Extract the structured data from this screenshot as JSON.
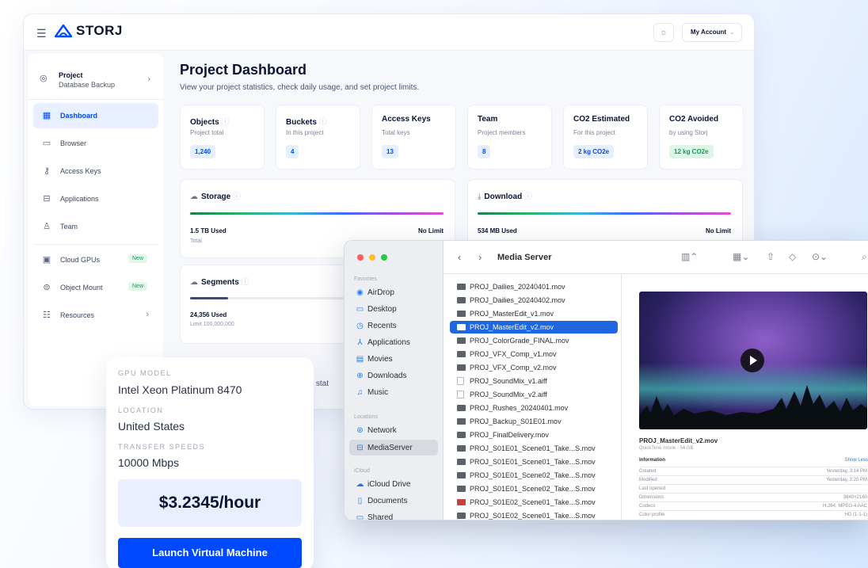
{
  "dashboard": {
    "brand": "STORJ",
    "account_label": "My Account",
    "project": {
      "label": "Project",
      "name": "Database Backup"
    },
    "nav": [
      {
        "label": "Dashboard",
        "icon": "grid-icon",
        "active": true
      },
      {
        "label": "Browser",
        "icon": "folder-icon"
      },
      {
        "label": "Access Keys",
        "icon": "key-icon"
      },
      {
        "label": "Applications",
        "icon": "apps-icon"
      },
      {
        "label": "Team",
        "icon": "user-icon"
      },
      {
        "label": "Cloud GPUs",
        "icon": "chip-icon",
        "badge": "New"
      },
      {
        "label": "Object Mount",
        "icon": "drive-icon",
        "badge": "New"
      },
      {
        "label": "Resources",
        "icon": "book-icon"
      }
    ],
    "title": "Project Dashboard",
    "subtitle": "View your project statistics, check daily usage, and set project limits.",
    "stats": [
      {
        "title": "Objects",
        "sub": "Project total",
        "value": "1,240"
      },
      {
        "title": "Buckets",
        "sub": "In this project",
        "value": "4"
      },
      {
        "title": "Access Keys",
        "sub": "Total keys",
        "value": "13"
      },
      {
        "title": "Team",
        "sub": "Project members",
        "value": "8"
      },
      {
        "title": "CO2 Estimated",
        "sub": "For this project",
        "value": "2 kg CO2e"
      },
      {
        "title": "CO2 Avoided",
        "sub": "by using Storj",
        "value": "12 kg CO2e"
      }
    ],
    "storage": {
      "title": "Storage",
      "used": "1.5 TB Used",
      "used_sub": "Total",
      "limit": "No Limit"
    },
    "download": {
      "title": "Download",
      "used": "534 MB Used",
      "limit": "No Limit"
    },
    "segments": {
      "title": "Segments",
      "used": "24,356 Used",
      "used_sub": "Limit 100,000,000",
      "fill_fraction": 0.15
    },
    "peek_text": "ge stat"
  },
  "gpu": {
    "model_label": "GPU MODEL",
    "model": "Intel Xeon Platinum 8470",
    "location_label": "LOCATION",
    "location": "United States",
    "speed_label": "TRANSFER SPEEDS",
    "speed": "10000 Mbps",
    "price": "$3.2345/hour",
    "launch_label": "Launch Virtual Machine"
  },
  "finder": {
    "title": "Media Server",
    "favorites_label": "Favorites",
    "favorites": [
      {
        "label": "AirDrop",
        "icon": "airdrop-icon"
      },
      {
        "label": "Desktop",
        "icon": "desktop-icon"
      },
      {
        "label": "Recents",
        "icon": "clock-icon"
      },
      {
        "label": "Applications",
        "icon": "applications-icon"
      },
      {
        "label": "Movies",
        "icon": "film-icon"
      },
      {
        "label": "Downloads",
        "icon": "download-icon"
      },
      {
        "label": "Music",
        "icon": "music-icon"
      }
    ],
    "locations_label": "Locations",
    "locations": [
      {
        "label": "Network",
        "icon": "globe-icon"
      },
      {
        "label": "MediaServer",
        "icon": "server-icon",
        "selected": true
      }
    ],
    "icloud_label": "iCloud",
    "icloud": [
      {
        "label": "iCloud Drive",
        "icon": "cloud-icon"
      },
      {
        "label": "Documents",
        "icon": "document-icon"
      },
      {
        "label": "Shared",
        "icon": "shared-icon"
      }
    ],
    "files": [
      {
        "name": "PROJ_Dailies_20240401.mov"
      },
      {
        "name": "PROJ_Dailies_20240402.mov"
      },
      {
        "name": "PROJ_MasterEdit_v1.mov"
      },
      {
        "name": "PROJ_MasterEdit_v2.mov",
        "selected": true
      },
      {
        "name": "PROJ_ColorGrade_FINAL.mov"
      },
      {
        "name": "PROJ_VFX_Comp_v1.mov"
      },
      {
        "name": "PROJ_VFX_Comp_v2.mov"
      },
      {
        "name": "PROJ_SoundMix_v1.aiff",
        "doc": true
      },
      {
        "name": "PROJ_SoundMix_v2.aiff",
        "doc": true
      },
      {
        "name": "PROJ_Rushes_20240401.mov"
      },
      {
        "name": "PROJ_Backup_S01E01.mov"
      },
      {
        "name": "PROJ_FinalDelivery.mov"
      },
      {
        "name": "PROJ_S01E01_Scene01_Take...S.mov"
      },
      {
        "name": "PROJ_S01E01_Scene01_Take...S.mov"
      },
      {
        "name": "PROJ_S01E01_Scene02_Take...S.mov"
      },
      {
        "name": "PROJ_S01E01_Scene02_Take...S.mov"
      },
      {
        "name": "PROJ_S01E02_Scene01_Take...S.mov"
      },
      {
        "name": "PROJ_S01E02_Scene01_Take...S.mov"
      }
    ],
    "preview": {
      "name": "PROJ_MasterEdit_v2.mov",
      "sub": "QuickTime movie - 54 GB",
      "info_label": "Information",
      "more_label": "Show Less",
      "rows": [
        {
          "k": "Created",
          "v": "Yesterday, 3:14 PM"
        },
        {
          "k": "Modified",
          "v": "Yesterday, 3:20 PM"
        },
        {
          "k": "Last opened",
          "v": ""
        },
        {
          "k": "Dimensions",
          "v": "3840×2160"
        },
        {
          "k": "Codecs",
          "v": "H.264, MPEG-4 AAC"
        },
        {
          "k": "Color profile",
          "v": "HD (1-1-1)"
        }
      ]
    }
  }
}
